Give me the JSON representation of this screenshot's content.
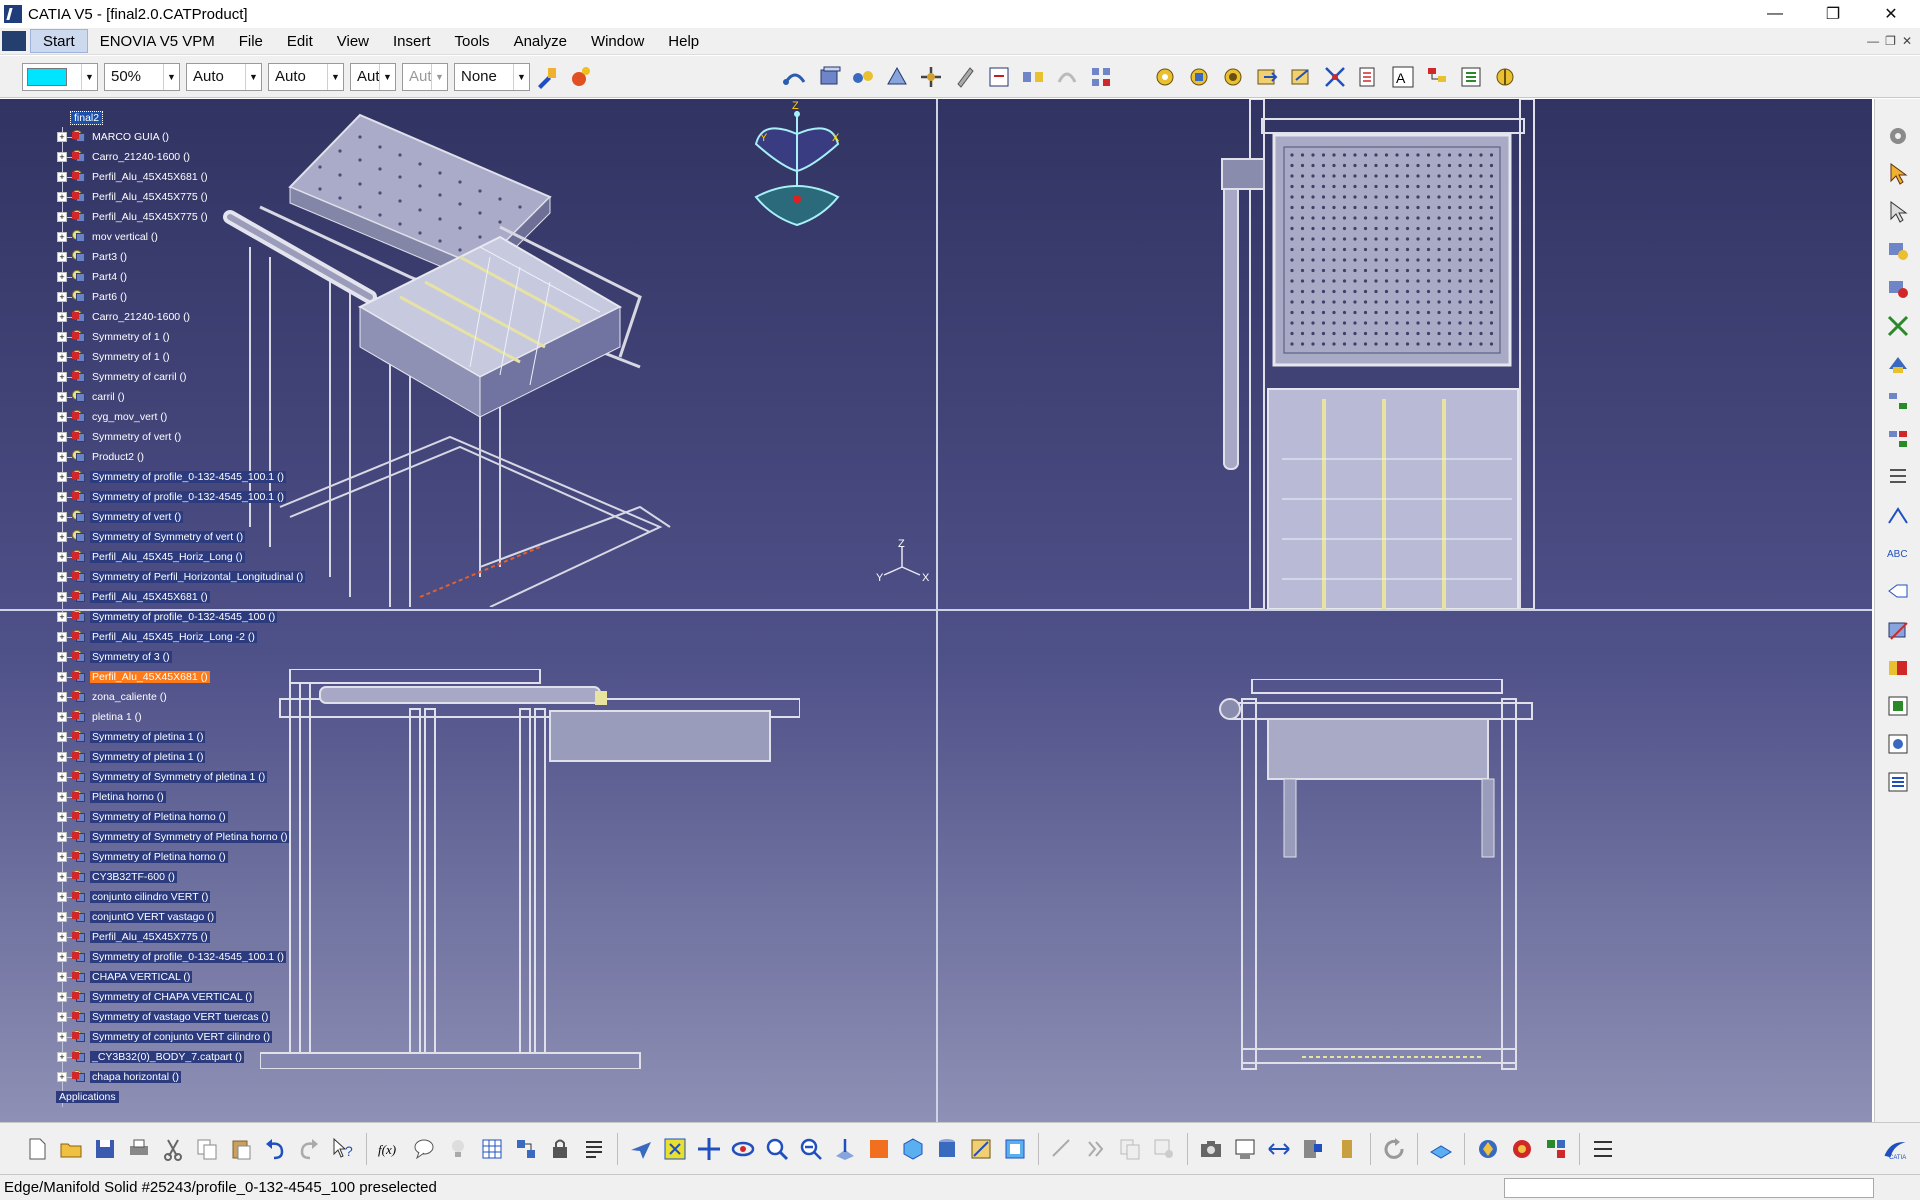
{
  "window": {
    "title": "CATIA V5 - [final2.0.CATProduct]"
  },
  "menu": {
    "items": [
      {
        "id": "start",
        "label": "Start",
        "active": true
      },
      {
        "id": "enovia",
        "label": "ENOVIA V5 VPM"
      },
      {
        "id": "file",
        "label": "File"
      },
      {
        "id": "edit",
        "label": "Edit"
      },
      {
        "id": "view",
        "label": "View"
      },
      {
        "id": "insert",
        "label": "Insert"
      },
      {
        "id": "tools",
        "label": "Tools"
      },
      {
        "id": "analyze",
        "label": "Analyze"
      },
      {
        "id": "window",
        "label": "Window"
      },
      {
        "id": "help",
        "label": "Help"
      }
    ]
  },
  "graphic_properties": {
    "color": "#00e5ff",
    "transparency": "50%",
    "line_thickness": "Auto",
    "line_type": "Auto",
    "point_type": "Aut",
    "rendering": "Aut",
    "layer": "None"
  },
  "spec_tree": {
    "root": "final2",
    "items": [
      "MARCO GUIA ()",
      "Carro_21240-1600 ()",
      "Perfil_Alu_45X45X681 ()",
      "Perfil_Alu_45X45X775 ()",
      "Perfil_Alu_45X45X775 ()",
      "mov vertical ()",
      "Part3 ()",
      "Part4 ()",
      "Part6 ()",
      "Carro_21240-1600 ()",
      "Symmetry of 1 ()",
      "Symmetry of 1 ()",
      "Symmetry of carril ()",
      "carril ()",
      "cyg_mov_vert ()",
      "Symmetry of vert ()",
      "Product2 ()",
      "Symmetry of profile_0-132-4545_100.1 ()",
      "Symmetry of profile_0-132-4545_100.1 ()",
      "Symmetry of vert ()",
      "Symmetry of Symmetry of vert ()",
      "Perfil_Alu_45X45_Horiz_Long ()",
      "Symmetry of Perfil_Horizontal_Longitudinal ()",
      "Perfil_Alu_45X45X681 ()",
      "Symmetry of profile_0-132-4545_100 ()",
      "Perfil_Alu_45X45_Horiz_Long -2 ()",
      "Symmetry of 3 ()",
      "Perfil_Alu_45X45X681 ()",
      "zona_caliente ()",
      "pletina 1 ()",
      "Symmetry of pletina 1 ()",
      "Symmetry of pletina 1 ()",
      "Symmetry of Symmetry of pletina 1 ()",
      "Pletina horno ()",
      "Symmetry of Pletina horno ()",
      "Symmetry of Symmetry of Pletina horno ()",
      "Symmetry of Pletina horno ()",
      "CY3B32TF-600 ()",
      "conjunto cilindro VERT ()",
      "conjuntO VERT vastago ()",
      "Perfil_Alu_45X45X775 ()",
      "Symmetry of profile_0-132-4545_100.1 ()",
      "CHAPA VERTICAL ()",
      "Symmetry of CHAPA VERTICAL ()",
      "Symmetry of vastago VERT tuercas ()",
      "Symmetry of conjunto VERT cilindro ()",
      "_CY3B32(0)_BODY_7.catpart ()",
      "chapa horizontal ()"
    ],
    "applications": "Applications"
  },
  "compass": {
    "x": "X",
    "y": "Y",
    "z": "Z"
  },
  "axis_triad": {
    "x": "X",
    "y": "Y",
    "z": "Z"
  },
  "status": {
    "message": "Edge/Manifold Solid #25243/profile_0-132-4545_100 preselected"
  }
}
